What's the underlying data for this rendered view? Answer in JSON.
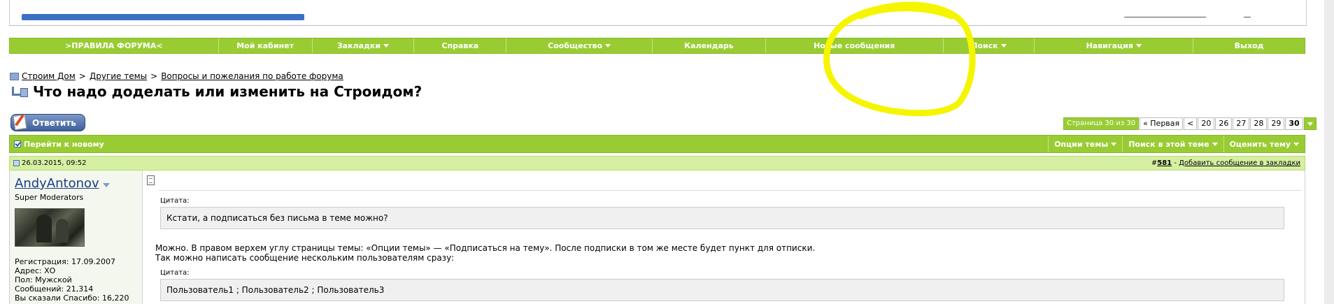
{
  "navbar": {
    "items": [
      {
        "label": ">ПРАВИЛА ФОРУМА<",
        "has_menu": false
      },
      {
        "label": "Мой кабинет",
        "has_menu": false
      },
      {
        "label": "Закладки",
        "has_menu": true
      },
      {
        "label": "Справка",
        "has_menu": false
      },
      {
        "label": "Сообщество",
        "has_menu": true
      },
      {
        "label": "Календарь",
        "has_menu": false
      },
      {
        "label": "Новые сообщения",
        "has_menu": false
      },
      {
        "label": "Поиск",
        "has_menu": true
      },
      {
        "label": "Навигация",
        "has_menu": true
      },
      {
        "label": "Выход",
        "has_menu": false
      }
    ]
  },
  "breadcrumb": {
    "items": [
      "Строим Дом",
      "Другие темы",
      "Вопросы и пожелания по работе форума"
    ],
    "separator": ">"
  },
  "thread": {
    "title": "Что надо доделать или изменить на Строидом?"
  },
  "reply_button": {
    "label": "Ответить"
  },
  "pagination": {
    "info": "Страница 30 из 30",
    "first": "« Первая",
    "prev": "<",
    "pages": [
      "20",
      "26",
      "27",
      "28",
      "29",
      "30"
    ],
    "current": "30"
  },
  "thread_bar": {
    "goto_new": "Перейти к новому",
    "options": [
      "Опции темы",
      "Поиск в этой теме",
      "Оценить тему"
    ]
  },
  "post": {
    "date": "26.03.2015, 09:52",
    "number_prefix": "#",
    "number": "581",
    "bookmark_sep": " - ",
    "bookmark": "Добавить сообщение в закладки",
    "user": {
      "name": "AndyAntonov",
      "title": "Super Moderators",
      "info": [
        "Регистрация: 17.09.2007",
        "Адрес: ХО",
        "Пол: Мужской",
        "Сообщений: 21,314",
        "Вы сказали Спасибо: 16,220"
      ]
    },
    "quote_label": "Цитата:",
    "quote1": "Кстати, а подписаться без письма в теме можно?",
    "text1": "Можно. В правом верхем углу страницы темы: «Опции темы» — «Подписаться на тему». После подписки в том же месте будет пункт для отписки.",
    "text2": "Так можно написать сообщение нескольким пользователям сразу:",
    "quote2": "Пользователь1 ; Пользователь2 ; Пользователь3"
  },
  "colors": {
    "navbar": "#99cc33",
    "post_header": "#d6f0a3",
    "annotation": "#f5f500",
    "username": "#1b3d85"
  },
  "icons": [
    "folder-icon",
    "thread-icon",
    "pencil-icon",
    "chevron-down-icon",
    "checkbox-icon",
    "post-icon",
    "document-icon",
    "avatar"
  ]
}
